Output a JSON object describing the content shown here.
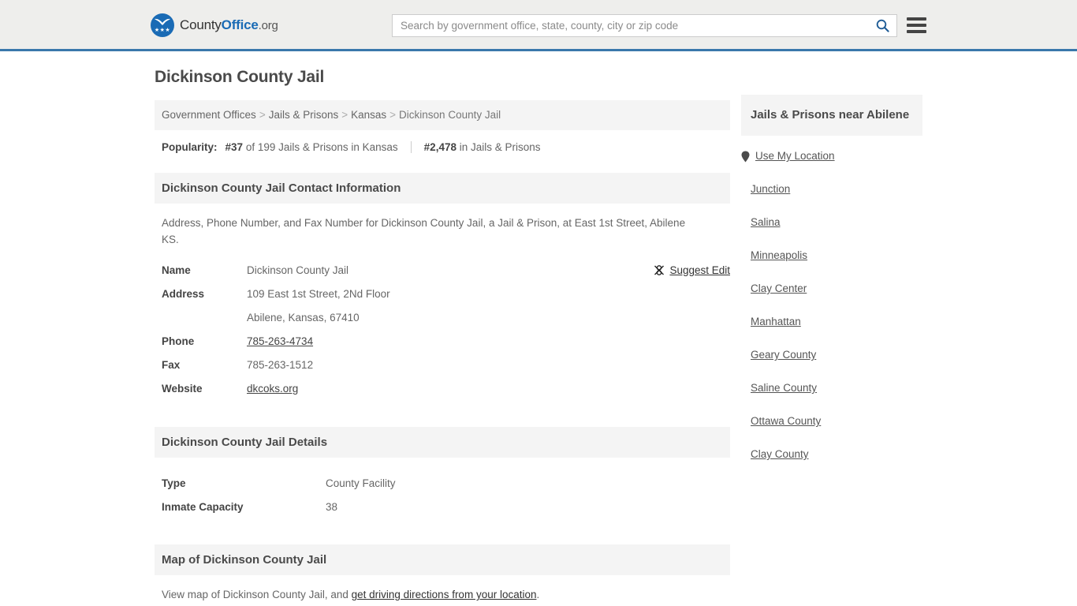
{
  "header": {
    "logo": {
      "part1": "County",
      "part2": "Office",
      "part3": ".org",
      "icon": "eagle-crest-icon"
    },
    "search": {
      "placeholder": "Search by government office, state, county, city or zip code",
      "value": "",
      "search_icon": "search-icon"
    },
    "menu_icon": "hamburger-menu-icon"
  },
  "main": {
    "page_title": "Dickinson County Jail",
    "breadcrumb": {
      "items": [
        "Government Offices",
        "Jails & Prisons",
        "Kansas",
        "Dickinson County Jail"
      ],
      "separator": ">"
    },
    "popularity": {
      "label": "Popularity:",
      "state_rank": "#37",
      "state_rank_text": "of 199 Jails & Prisons in Kansas",
      "national_rank": "#2,478",
      "national_rank_text": "in Jails & Prisons"
    },
    "contact_section": {
      "heading": "Dickinson County Jail Contact Information",
      "description": "Address, Phone Number, and Fax Number for Dickinson County Jail, a Jail & Prison, at East 1st Street, Abilene KS.",
      "suggest_edit": {
        "label": "Suggest Edit",
        "icon": "suggest-edit-icon"
      },
      "rows": [
        {
          "key": "Name",
          "value": "Dickinson County Jail",
          "link": false
        },
        {
          "key": "Address",
          "value": "109 East 1st Street, 2Nd Floor",
          "link": false
        },
        {
          "key": "",
          "value": "Abilene, Kansas, 67410",
          "link": false
        },
        {
          "key": "Phone",
          "value": "785-263-4734",
          "link": true
        },
        {
          "key": "Fax",
          "value": "785-263-1512",
          "link": false
        },
        {
          "key": "Website",
          "value": "dkcoks.org",
          "link": true
        }
      ]
    },
    "details_section": {
      "heading": "Dickinson County Jail Details",
      "rows": [
        {
          "key": "Type",
          "value": "County Facility"
        },
        {
          "key": "Inmate Capacity",
          "value": "38"
        }
      ]
    },
    "map_section": {
      "heading": "Map of Dickinson County Jail",
      "text_before": "View map of Dickinson County Jail, and ",
      "link_text": "get driving directions from your location",
      "text_after": "."
    }
  },
  "sidebar": {
    "heading": "Jails & Prisons near Abilene",
    "use_my_location": {
      "label": "Use My Location",
      "icon": "map-pin-icon"
    },
    "links": [
      "Junction",
      "Salina",
      "Minneapolis",
      "Clay Center",
      "Manhattan",
      "Geary County",
      "Saline County",
      "Ottawa County",
      "Clay County"
    ]
  },
  "colors": {
    "brand_blue": "#1a6bb5",
    "header_border": "#3a78ab",
    "header_bg": "#eeeeec",
    "band_bg": "#f4f4f4",
    "text_dark": "#4a4a4a",
    "text_muted": "#666666"
  }
}
